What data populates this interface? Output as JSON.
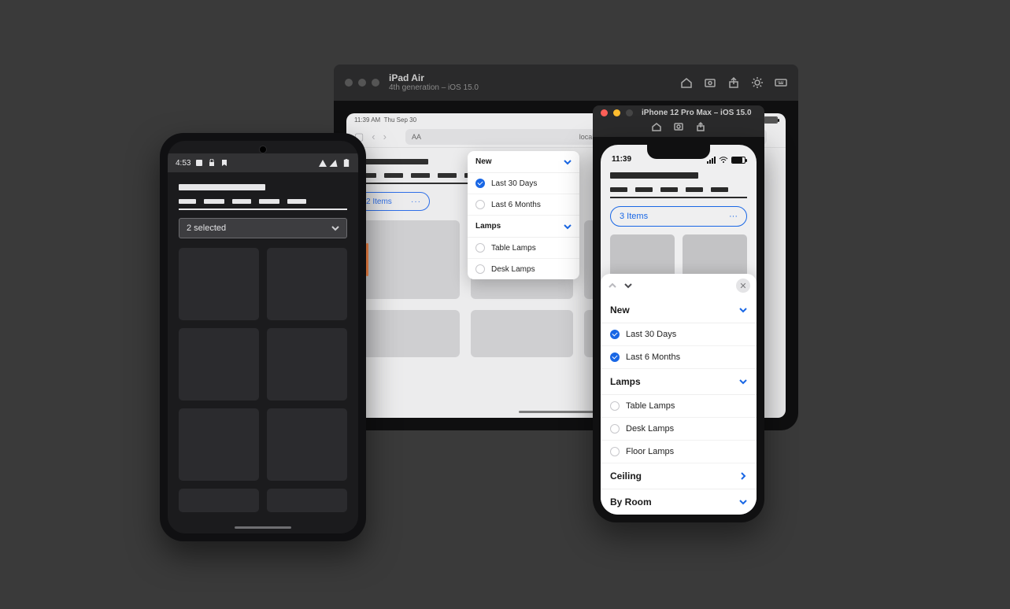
{
  "ipad": {
    "title": "iPad Air",
    "subtitle": "4th generation – iOS 15.0",
    "status": {
      "time": "11:39 AM",
      "date": "Thu Sep 30"
    },
    "safari": {
      "aa": "AA",
      "host": "localhost"
    },
    "filter_pill": {
      "label": "2 Items",
      "more": "···"
    },
    "popover": {
      "sections": [
        {
          "title": "New",
          "items": [
            {
              "label": "Last 30 Days",
              "checked": true
            },
            {
              "label": "Last 6 Months",
              "checked": false
            }
          ]
        },
        {
          "title": "Lamps",
          "items": [
            {
              "label": "Table Lamps",
              "checked": false
            },
            {
              "label": "Desk Lamps",
              "checked": false
            }
          ]
        }
      ]
    }
  },
  "iphone": {
    "title": "iPhone 12 Pro Max – iOS 15.0",
    "status_time": "11:39",
    "filter_pill": {
      "label": "3 Items",
      "more": "···"
    },
    "sheet": {
      "sections": [
        {
          "title": "New",
          "kind": "open",
          "items": [
            {
              "label": "Last 30 Days",
              "checked": true
            },
            {
              "label": "Last 6 Months",
              "checked": true
            }
          ]
        },
        {
          "title": "Lamps",
          "kind": "open",
          "items": [
            {
              "label": "Table Lamps",
              "checked": false
            },
            {
              "label": "Desk Lamps",
              "checked": false
            },
            {
              "label": "Floor Lamps",
              "checked": false
            }
          ]
        },
        {
          "title": "Ceiling",
          "kind": "nav"
        },
        {
          "title": "By Room",
          "kind": "closed"
        }
      ]
    }
  },
  "android": {
    "status_time": "4:53",
    "select_label": "2 selected"
  }
}
